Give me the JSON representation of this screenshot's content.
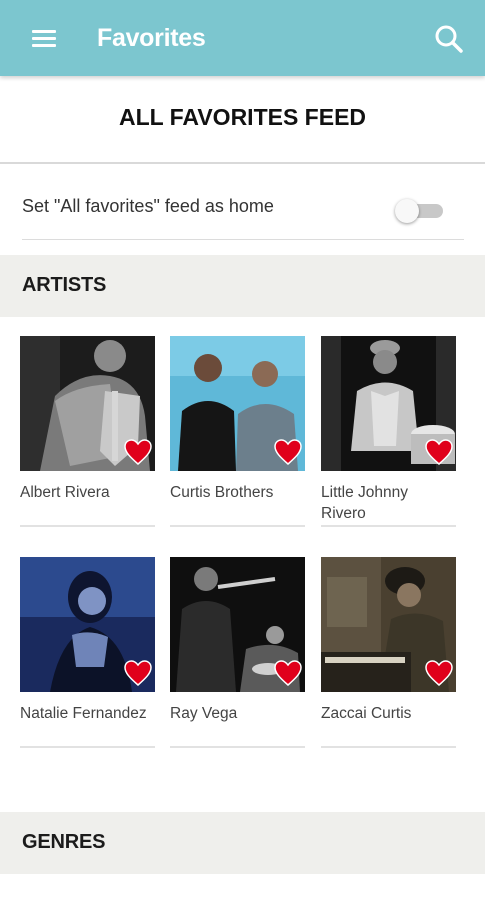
{
  "appbar": {
    "title": "Favorites",
    "menu_icon": "hamburger-menu-icon",
    "search_icon": "search-icon",
    "background_color": "#7cc6cf"
  },
  "feed": {
    "title": "ALL FAVORITES FEED",
    "home_toggle_label": "Set \"All favorites\" feed as home",
    "home_toggle_on": false
  },
  "sections": {
    "artists_label": "ARTISTS",
    "genres_label": "GENRES"
  },
  "artists": [
    {
      "name": "Albert Rivera",
      "favorited": true,
      "tone": "bw"
    },
    {
      "name": "Curtis Brothers",
      "favorited": true,
      "tone": "color"
    },
    {
      "name": "Little Johnny Rivero",
      "favorited": true,
      "tone": "bw"
    },
    {
      "name": "Natalie Fernandez",
      "favorited": true,
      "tone": "blue"
    },
    {
      "name": "Ray Vega",
      "favorited": true,
      "tone": "bw"
    },
    {
      "name": "Zaccai Curtis",
      "favorited": true,
      "tone": "warm"
    }
  ],
  "colors": {
    "heart": "#e0001b",
    "section_bg": "#efefec"
  }
}
